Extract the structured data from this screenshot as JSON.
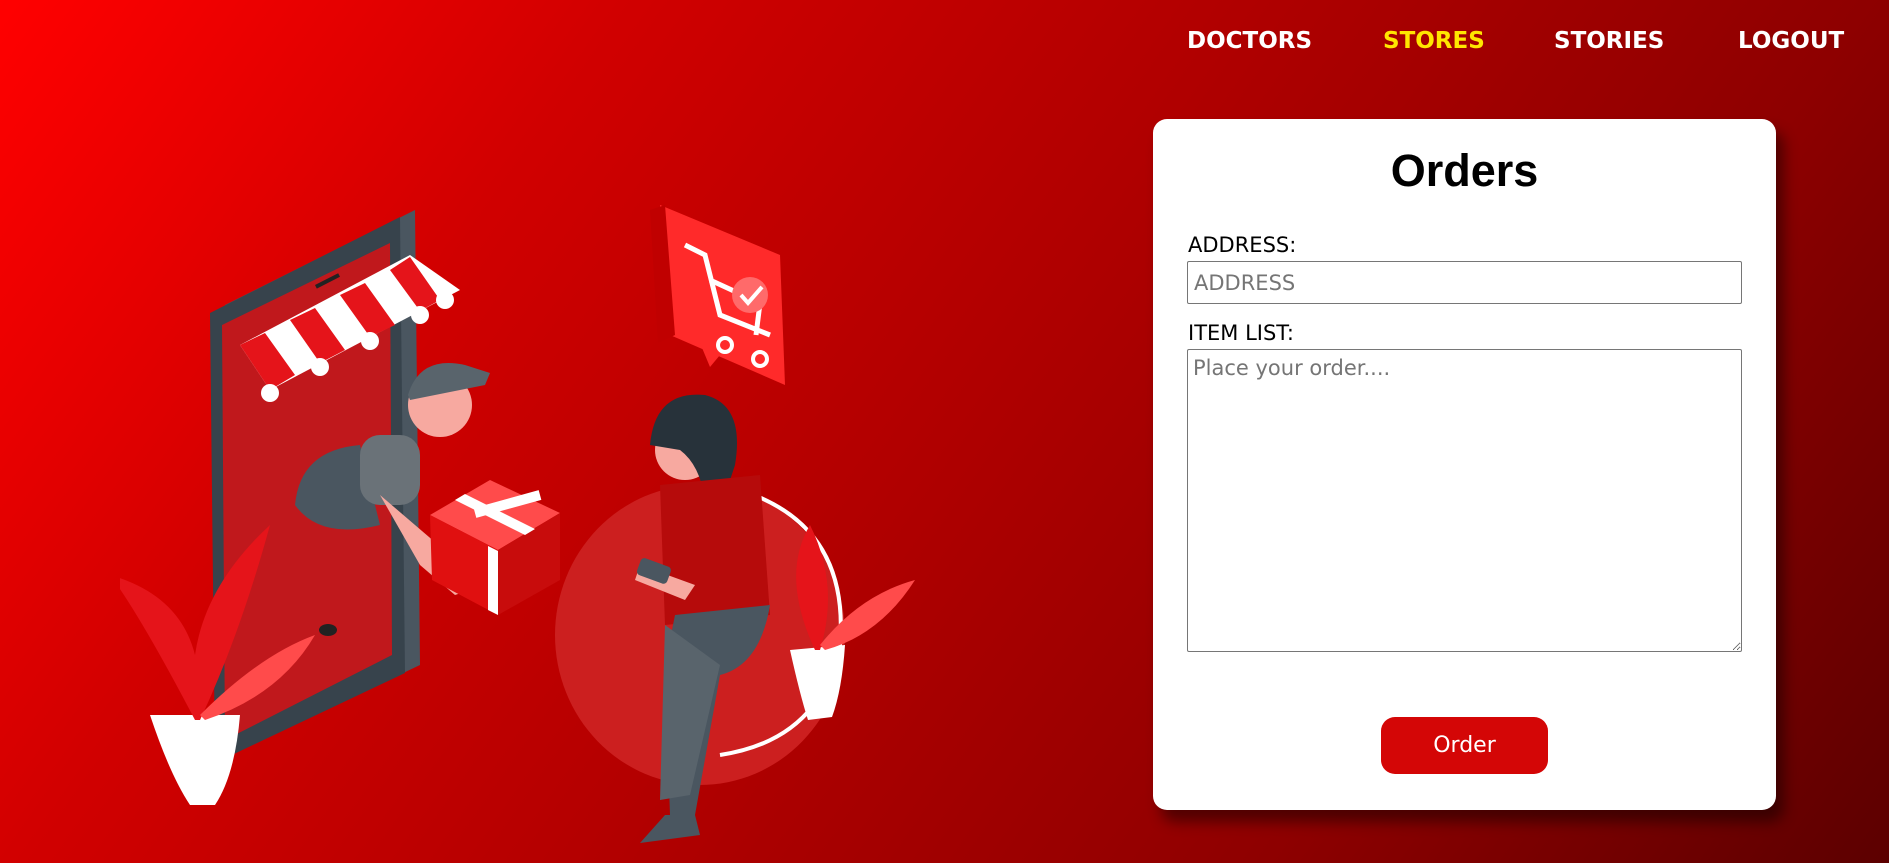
{
  "nav": {
    "items": [
      {
        "label": "DOCTORS",
        "active": false
      },
      {
        "label": "STORES",
        "active": true
      },
      {
        "label": "STORIES",
        "active": false
      },
      {
        "label": "LOGOUT",
        "active": false
      }
    ]
  },
  "illustration": {
    "subject": "delivery person handing a package from a phone storefront to a seated woman with a phone, shopping cart speech bubble, potted plants"
  },
  "orders_form": {
    "title": "Orders",
    "address_label": "ADDRESS:",
    "address_placeholder": "ADDRESS",
    "address_value": "",
    "items_label": "ITEM LIST:",
    "items_placeholder": "Place your order....",
    "items_value": "",
    "submit_label": "Order"
  },
  "colors": {
    "accent": "#d40606",
    "active_nav": "#ffe600",
    "background_start": "#ff0000",
    "background_end": "#5c0000"
  }
}
